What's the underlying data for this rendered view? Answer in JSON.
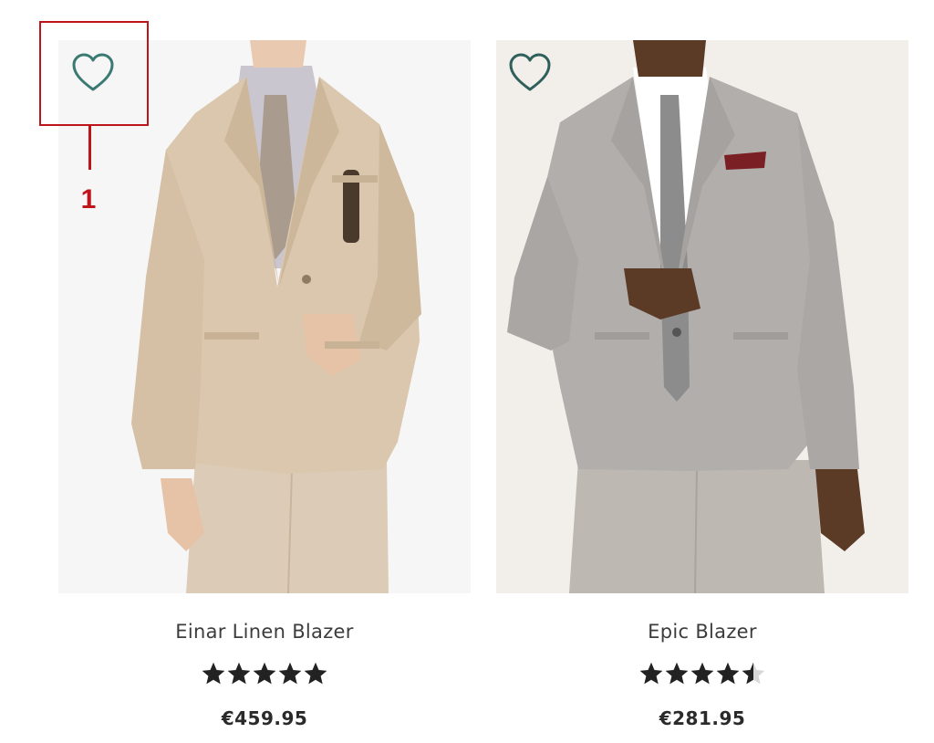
{
  "colors": {
    "heart": "#3b7a72",
    "callout": "#c0141b",
    "star_filled": "#222222",
    "star_empty": "#d8d8d8"
  },
  "annotation": {
    "callout_label": "1"
  },
  "products": [
    {
      "name": "Einar Linen Blazer",
      "price": "€459.95",
      "rating": 5,
      "wishlist_icon": "heart-outline-icon",
      "image_alt": "Einar Linen Blazer"
    },
    {
      "name": "Epic Blazer",
      "price": "€281.95",
      "rating": 4.5,
      "wishlist_icon": "heart-outline-icon",
      "image_alt": "Epic Blazer"
    }
  ]
}
